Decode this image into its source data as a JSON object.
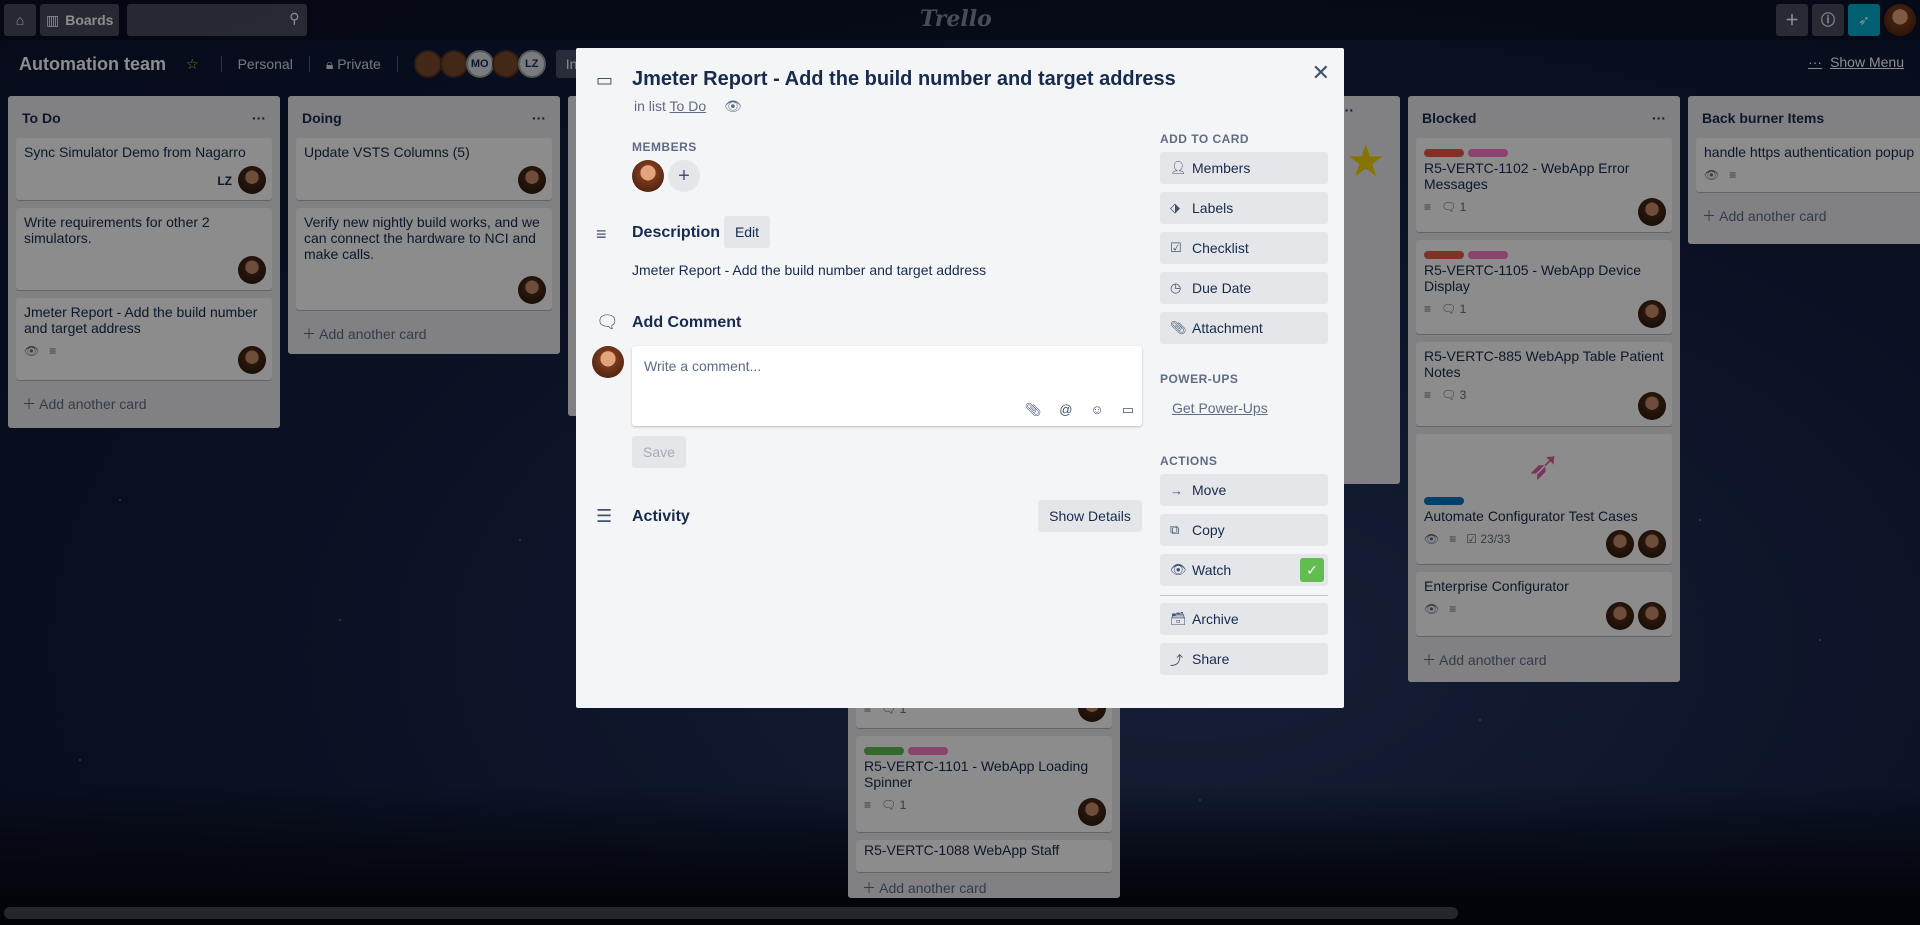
{
  "topbar": {
    "boards_label": "Boards",
    "logo": "Trello",
    "search_value": ""
  },
  "board": {
    "title": "Automation team",
    "personal_label": "Personal",
    "private_label": "Private",
    "invite_label": "Invi",
    "member_initials": [
      "MO",
      "LZ"
    ],
    "show_menu_label": "Show Menu"
  },
  "lists": {
    "todo": {
      "title": "To Do",
      "cards": [
        {
          "title": "Sync Simulator Demo from Nagarro",
          "initials": "LZ"
        },
        {
          "title": "Write requirements for other 2 simulators."
        },
        {
          "title": "Jmeter Report - Add the build number and target address"
        }
      ],
      "add_card": "Add another card"
    },
    "doing": {
      "title": "Doing",
      "cards": [
        {
          "title": "Update VSTS Columns (5)"
        },
        {
          "title": "Verify new nightly build works, and we can connect the hardware to NCI and make calls."
        }
      ],
      "add_card": "Add another card"
    },
    "middle": {
      "cards": [
        {
          "comments": "1"
        },
        {
          "title": "R5-VERTC-1101 - WebApp Loading Spinner",
          "comments": "1"
        },
        {
          "title": "R5-VERTC-1088 WebApp Staff"
        }
      ],
      "add_card": "Add another card"
    },
    "blocked": {
      "title": "Blocked",
      "cards": [
        {
          "title": "R5-VERTC-1102 - WebApp Error Messages",
          "comments": "1"
        },
        {
          "title": "R5-VERTC-1105 - WebApp Device Display",
          "comments": "1"
        },
        {
          "title": "R5-VERTC-885 WebApp Table Patient Notes",
          "comments": "3"
        },
        {
          "title": "Automate Configurator Test Cases",
          "checklist": "23/33"
        },
        {
          "title": "Enterprise Configurator"
        }
      ],
      "add_card": "Add another card"
    },
    "backburner": {
      "title": "Back burner Items",
      "cards": [
        {
          "title": "handle https authentication popup"
        }
      ],
      "add_card": "Add another card"
    }
  },
  "modal": {
    "title": "Jmeter Report - Add the build number and target address",
    "in_list_prefix": "in list",
    "in_list_name": "To Do",
    "members_heading": "MEMBERS",
    "description_heading": "Description",
    "edit_label": "Edit",
    "description_text": "Jmeter Report - Add the build number and target address",
    "comment_heading": "Add Comment",
    "comment_placeholder": "Write a comment...",
    "save_label": "Save",
    "activity_heading": "Activity",
    "show_details_label": "Show Details",
    "add_to_card_heading": "ADD TO CARD",
    "add_to_card": [
      "Members",
      "Labels",
      "Checklist",
      "Due Date",
      "Attachment"
    ],
    "powerups_heading": "POWER-UPS",
    "get_powerups": "Get Power-Ups",
    "actions_heading": "ACTIONS",
    "actions": [
      "Move",
      "Copy",
      "Watch"
    ],
    "archive_label": "Archive",
    "share_label": "Share"
  },
  "colors": {
    "label_red": "#eb5a46",
    "label_pink": "#ff78cb",
    "label_green": "#61bd4f",
    "label_blue": "#0079bf",
    "watch_check": "#61bd4f"
  }
}
